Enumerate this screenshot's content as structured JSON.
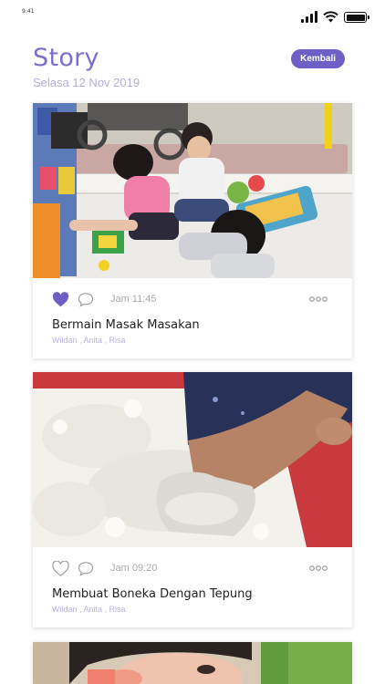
{
  "status": {
    "time": "9:41"
  },
  "header": {
    "title": "Story",
    "date": "Selasa 12 Nov 2019",
    "back_label": "Kembali"
  },
  "colors": {
    "accent": "#6e5fc6",
    "title": "#7b6fc9",
    "date": "#b3acdb",
    "people": "#b7b1dc"
  },
  "posts": [
    {
      "time": "Jam 11:45",
      "title": "Bermain Masak Masakan",
      "people": "Wildan , Anita , Risa",
      "liked": true
    },
    {
      "time": "Jam 09:20",
      "title": "Membuat Boneka Dengan Tepung",
      "people": "Wildan , Anita , Risa",
      "liked": false
    }
  ]
}
